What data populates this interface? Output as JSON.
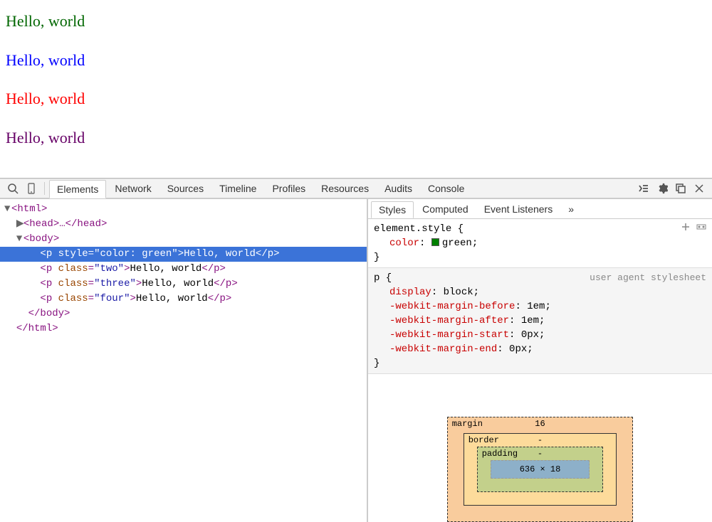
{
  "preview": {
    "p1": {
      "text": "Hello, world",
      "color": "#006600"
    },
    "p2": {
      "text": "Hello, world",
      "color": "#0000ff"
    },
    "p3": {
      "text": "Hello, world",
      "color": "#ff0000"
    },
    "p4": {
      "text": "Hello, world",
      "color": "#660066"
    }
  },
  "toolbar": {
    "tabs": [
      "Elements",
      "Network",
      "Sources",
      "Timeline",
      "Profiles",
      "Resources",
      "Audits",
      "Console"
    ],
    "active": "Elements"
  },
  "dom": {
    "l0": "▼",
    "html_open": "<html>",
    "head": "<head>…</head>",
    "body_open": "<body>",
    "p1_open": "<p ",
    "p1_attr_name": "style",
    "p1_attr_val": "\"color: green\"",
    "p1_text": "Hello, world",
    "p_close": "</p>",
    "p2_open": "<p ",
    "p2_attr_name": "class",
    "p2_attr_val": "\"two\"",
    "p2_text": "Hello, world",
    "p3_attr_val": "\"three\"",
    "p3_text": "Hello, world",
    "p4_attr_val": "\"four\"",
    "p4_text": "Hello, world",
    "body_close": "</body>",
    "html_close": "</html>"
  },
  "styles": {
    "tabs": [
      "Styles",
      "Computed",
      "Event Listeners"
    ],
    "more": "»",
    "rule1": {
      "selector": "element.style {",
      "prop": "color",
      "val": "green;",
      "close": "}"
    },
    "rule2": {
      "selector": "p {",
      "origin": "user agent stylesheet",
      "props": [
        {
          "name": "display",
          "val": "block;"
        },
        {
          "name": "-webkit-margin-before",
          "val": "1em;"
        },
        {
          "name": "-webkit-margin-after",
          "val": "1em;"
        },
        {
          "name": "-webkit-margin-start",
          "val": "0px;"
        },
        {
          "name": "-webkit-margin-end",
          "val": "0px;"
        }
      ],
      "close": "}"
    }
  },
  "boxModel": {
    "margin_label": "margin",
    "margin_top": "16",
    "border_label": "border",
    "border_top": "-",
    "padding_label": "padding",
    "padding_top": "-",
    "content": "636 × 18"
  }
}
